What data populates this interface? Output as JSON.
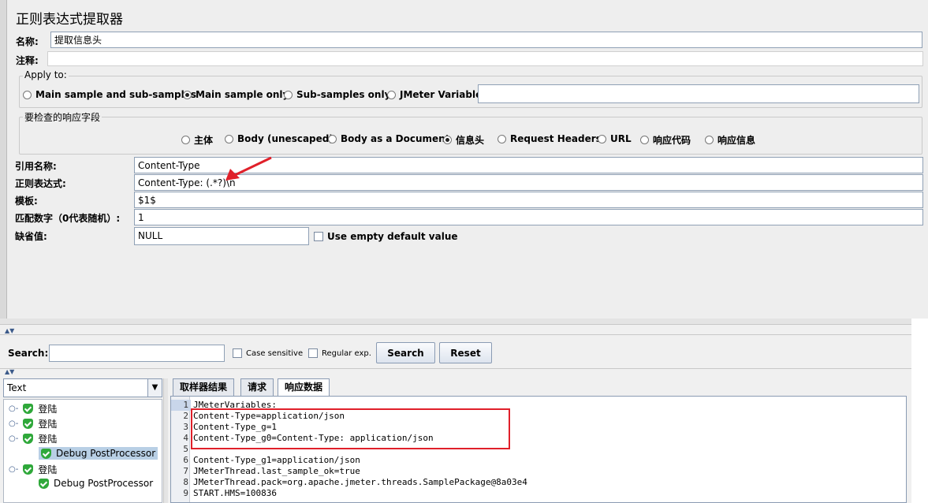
{
  "panel": {
    "title": "正则表达式提取器",
    "name_label": "名称:",
    "name_value": "提取信息头",
    "comment_label": "注释:",
    "comment_value": ""
  },
  "apply_to": {
    "title": "Apply to:",
    "options": [
      "Main sample and sub-samples",
      "Main sample only",
      "Sub-samples only",
      "JMeter Variable"
    ],
    "selected": "Main sample only",
    "variable_value": ""
  },
  "field_to_check": {
    "title": "要检查的响应字段",
    "options": [
      "主体",
      "Body (unescaped)",
      "Body as a Document",
      "信息头",
      "Request Headers",
      "URL",
      "响应代码",
      "响应信息"
    ],
    "selected": "信息头"
  },
  "fields": {
    "ref_name_label": "引用名称:",
    "ref_name_value": "Content-Type",
    "regex_label": "正则表达式:",
    "regex_value": "Content-Type: (.*?)\\n",
    "template_label": "模板:",
    "template_value": "$1$",
    "match_no_label": "匹配数字（0代表随机）:",
    "match_no_value": "1",
    "default_label": "缺省值:",
    "default_value": "NULL",
    "use_empty_label": "Use empty default value"
  },
  "search": {
    "label": "Search:",
    "value": "",
    "case_sensitive": "Case sensitive",
    "regular_exp": "Regular exp.",
    "search_button": "Search",
    "reset_button": "Reset"
  },
  "renderer": {
    "selected": "Text"
  },
  "tree": {
    "items": [
      {
        "label": "登陆",
        "level": 0
      },
      {
        "label": "登陆",
        "level": 0
      },
      {
        "label": "登陆",
        "level": 0
      },
      {
        "label": "Debug PostProcessor",
        "level": 1,
        "selected": true
      },
      {
        "label": "登陆",
        "level": 0
      },
      {
        "label": "Debug PostProcessor",
        "level": 1,
        "selected": false
      }
    ]
  },
  "tabs": [
    "取样器结果",
    "请求",
    "响应数据"
  ],
  "active_tab": "响应数据",
  "response_lines": [
    {
      "n": "1",
      "text": "JMeterVariables:"
    },
    {
      "n": "2",
      "text": "Content-Type=application/json"
    },
    {
      "n": "3",
      "text": "Content-Type_g=1"
    },
    {
      "n": "4",
      "text": "Content-Type_g0=Content-Type: application/json"
    },
    {
      "n": "5",
      "text": ""
    },
    {
      "n": "6",
      "text": "Content-Type_g1=application/json"
    },
    {
      "n": "7",
      "text": "JMeterThread.last_sample_ok=true"
    },
    {
      "n": "8",
      "text": "JMeterThread.pack=org.apache.jmeter.threads.SamplePackage@8a03e4"
    },
    {
      "n": "9",
      "text": "START.HMS=100836"
    }
  ],
  "colors": {
    "annotation": "#e0202a",
    "selection": "#b8cfe5",
    "panel_bg": "#eeeeee"
  }
}
